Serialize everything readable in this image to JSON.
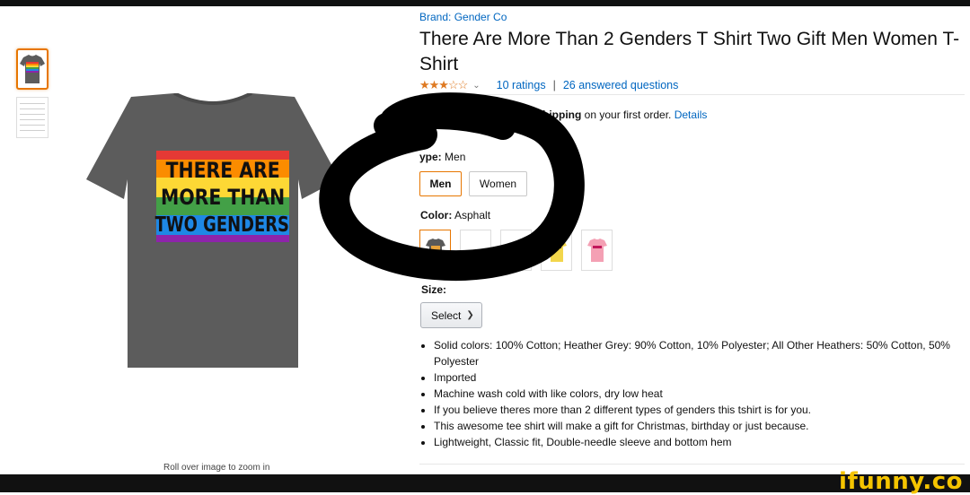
{
  "product": {
    "brand": "Brand: Gender Co",
    "title": "There Are More Than 2 Genders T Shirt Two Gift Men Women T-Shirt",
    "stars": "★★★☆☆",
    "rating_value": 2.5,
    "ratings_link": "10 ratings",
    "questions_link": "26 answered questions"
  },
  "image": {
    "shirt_text_lines": [
      "THERE ARE",
      "MORE THAN",
      "TWO GENDERS"
    ],
    "zoom_hint": "Roll over image to zoom in"
  },
  "shipping": {
    "bold": "FREE Shipping",
    "visible_bold": "Shipping",
    "rest": " on your first order. ",
    "details_link": "Details"
  },
  "fit_type": {
    "label": "Fit Type:",
    "visible_label": "ype:",
    "value": "Men",
    "options": [
      "Men",
      "Women"
    ]
  },
  "color": {
    "label": "Color:",
    "value": "Asphalt",
    "swatches": [
      "#595959",
      "#ffffff",
      "#ffffff",
      "#f2d64b",
      "#f4a0b4"
    ]
  },
  "size": {
    "label": "Size:",
    "select_label": "Select"
  },
  "bullets": [
    "Solid colors: 100% Cotton; Heather Grey: 90% Cotton, 10% Polyester; All Other Heathers: 50% Cotton, 50% Polyester",
    "Imported",
    "Machine wash cold with like colors, dry low heat",
    "If you believe theres more than 2 different types of genders this tshirt is for you.",
    "This awesome tee shirt will make a gift for Christmas, birthday or just because.",
    "Lightweight, Classic fit, Double-needle sleeve and bottom hem"
  ],
  "watermark": "ifunny.co",
  "colors": {
    "link": "#0066c0",
    "star": "#de7921",
    "selected_border": "#e77600",
    "shirt": "#5c5c5c",
    "watermark": "#f5c400"
  }
}
